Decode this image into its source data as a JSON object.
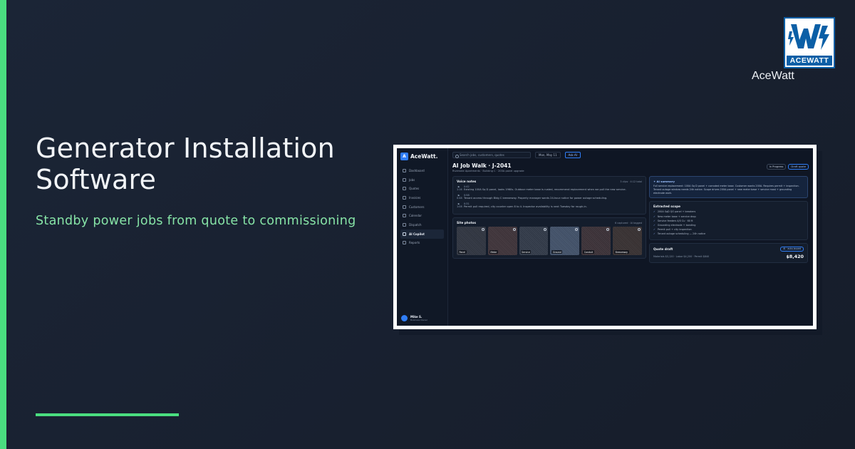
{
  "hero": {
    "title": "Generator Installation Software",
    "subtitle": "Standby power jobs from quote to commissioning"
  },
  "brand": {
    "logo_word": "ACEWATT",
    "name": "AceWatt"
  },
  "colors": {
    "accent": "#4ade80",
    "background": "#1b2536",
    "logo_blue": "#0b5fa6",
    "app_primary": "#2f7df6"
  },
  "app": {
    "brand": "AceWatt.",
    "brand_initial": "A",
    "nav": [
      {
        "label": "Dashboard",
        "icon": "dashboard-icon"
      },
      {
        "label": "Jobs",
        "icon": "briefcase-icon"
      },
      {
        "label": "Quotes",
        "icon": "document-icon"
      },
      {
        "label": "Invoices",
        "icon": "invoice-icon"
      },
      {
        "label": "Customers",
        "icon": "users-icon"
      },
      {
        "label": "Calendar",
        "icon": "calendar-icon"
      },
      {
        "label": "Dispatch",
        "icon": "truck-icon"
      },
      {
        "label": "AI Copilot",
        "icon": "sparkle-icon",
        "active": true
      },
      {
        "label": "Reports",
        "icon": "chart-icon"
      }
    ],
    "user": {
      "name": "Mike S.",
      "role": "Business Owner"
    },
    "topbar": {
      "search_placeholder": "Search jobs, customers, quotes",
      "date": "Mon, May 11",
      "ask_ai": "Ask AI"
    },
    "page": {
      "title": "AI Job Walk · J-2041",
      "subtitle": "Riverside Apartments · Building C · 200A panel upgrade",
      "status": "In Progress",
      "draft_button": "Draft quote"
    },
    "voice_notes": {
      "title": "Voice notes",
      "meta": "3 clips · 4:12 total",
      "items": [
        {
          "time": "0:42",
          "duration": "1:16",
          "text": "Existing 100A Sq D panel, looks 1960s. Outdoor meter base is rusted, recommend replacement when we pull the new service."
        },
        {
          "time": "0:58",
          "duration": "0:48",
          "text": "Tenant access through Bldg C breezeway. Property manager wants 24-hour notice for power outage scheduling."
        },
        {
          "time": "0:31",
          "duration": "1:08",
          "text": "Permit pull required, city counter open 8 to 4. Inspector availability is next Tuesday for rough-in."
        }
      ]
    },
    "site_photos": {
      "title": "Site photos",
      "meta": "6 captured · AI tagged",
      "items": [
        "Panel",
        "Meter",
        "Service",
        "Ground",
        "Conduit",
        "Breezeway"
      ]
    },
    "ai_summary": {
      "title": "AI summary",
      "text": "Full service replacement: 100A Sq D panel + corroded meter base. Customer wants 200A. Requires permit + inspection. Tenant outage window needs 24h notice. Scope drives 200A panel + new meter base + service mast + grounding electrode work."
    },
    "scope": {
      "title": "Extracted scope",
      "items": [
        "200A SqD QO panel + breakers",
        "New meter base + service drop",
        "Service feeders 4/0 Cu · 60 ft",
        "Grounding electrode + bonding",
        "Permit pull + city inspection",
        "Tenant outage scheduling — 24h notice"
      ]
    },
    "quote": {
      "title": "Quote draft",
      "badge": "AI · auto-issued",
      "detail": "Materials $3,120 · Labor $4,200 · Permit $840",
      "total": "$8,420"
    }
  }
}
